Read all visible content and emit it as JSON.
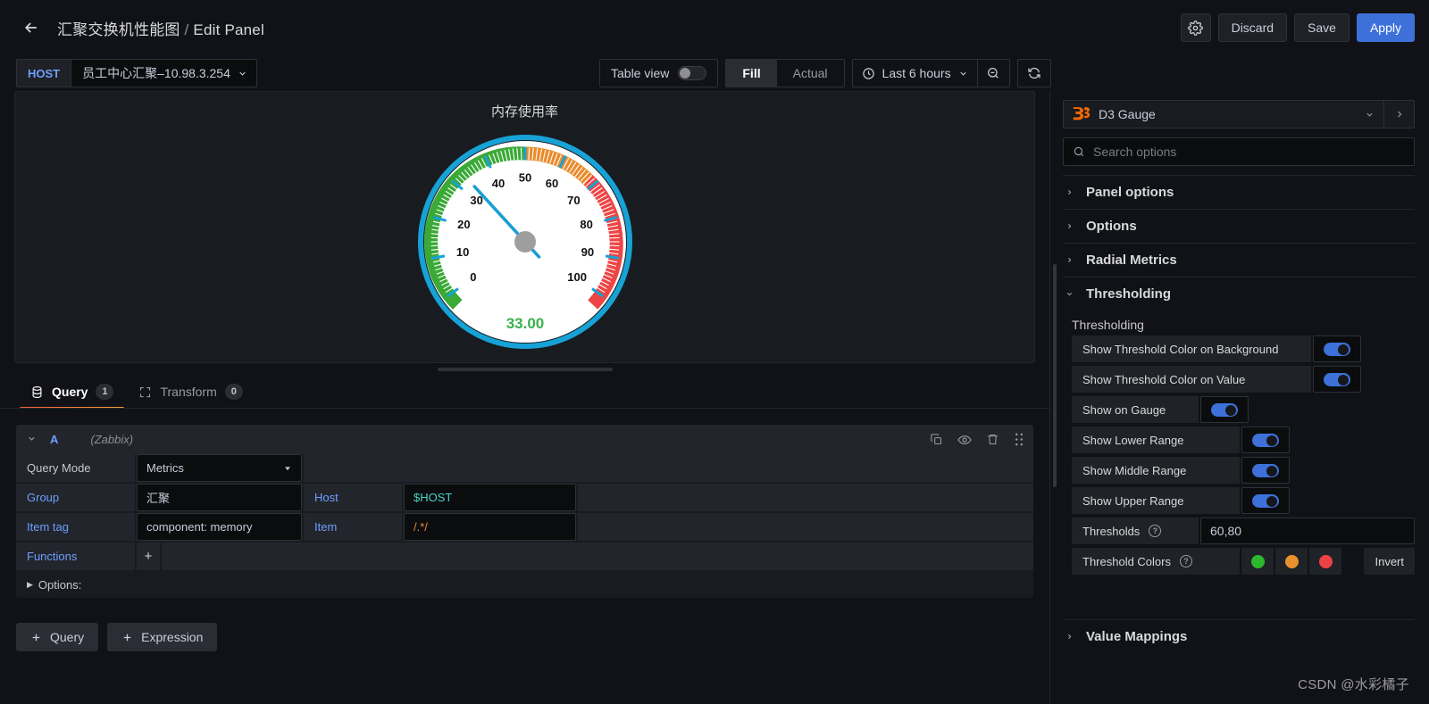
{
  "topbar": {
    "back_icon": "arrow-left-icon",
    "dashboard_title": "汇聚交换机性能图",
    "separator": "/",
    "page_title": "Edit Panel",
    "settings_icon": "gear-icon",
    "discard_label": "Discard",
    "save_label": "Save",
    "apply_label": "Apply"
  },
  "subbar": {
    "variable_label": "HOST",
    "variable_value": "员工中心汇聚–10.98.3.254",
    "table_view_label": "Table view",
    "table_view_on": false,
    "fill_label": "Fill",
    "actual_label": "Actual",
    "selected_size": "Fill",
    "time_range": "Last 6 hours",
    "clock_icon": "clock-icon",
    "zoom_out_icon": "zoom-out-icon",
    "refresh_icon": "refresh-icon"
  },
  "panel": {
    "title": "内存使用率",
    "value_text": "33.00",
    "value_color": "#37b24d"
  },
  "chart_data": {
    "type": "gauge",
    "title": "内存使用率",
    "value": 33.0,
    "value_label": "33.00",
    "min": 0,
    "max": 100,
    "tick_labels": [
      0,
      10,
      20,
      30,
      40,
      50,
      60,
      70,
      80,
      90,
      100
    ],
    "major_tick_step": 10,
    "minor_ticks_per_major": 10,
    "thresholds": [
      60,
      80
    ],
    "bands": [
      {
        "from": 0,
        "to": 60,
        "color": "#3aa935"
      },
      {
        "from": 60,
        "to": 80,
        "color": "#e98b2c"
      },
      {
        "from": 80,
        "to": 100,
        "color": "#ef4444"
      }
    ],
    "needle_color": "#1a9fd4",
    "hub_color": "#9e9e9e",
    "outer_ring_color": "#17a2d6",
    "face_color": "#ffffff",
    "background_color": "#181b1f",
    "value_color": "#37b24d",
    "start_angle_deg": -125,
    "end_angle_deg": 125
  },
  "tabs": {
    "query": {
      "label": "Query",
      "badge": "1",
      "icon": "database-icon",
      "active": true
    },
    "transform": {
      "label": "Transform",
      "badge": "0",
      "icon": "transform-icon",
      "active": false
    }
  },
  "query": {
    "ref_id": "A",
    "datasource": "(Zabbix)",
    "actions": [
      "copy-icon",
      "eye-icon",
      "trash-icon",
      "drag-handle-icon"
    ],
    "rows": [
      {
        "label": "Query Mode",
        "label_style": "plain",
        "value": "Metrics",
        "control": "select"
      }
    ],
    "group_label": "Group",
    "group_value": "汇聚",
    "host_label": "Host",
    "host_value": "$HOST",
    "item_tag_label": "Item tag",
    "item_tag_value": "component: memory",
    "item_label": "Item",
    "item_value": "/.*/",
    "functions_label": "Functions",
    "functions_add": "+",
    "options_label": "Options:",
    "add_query_label": "Query",
    "add_expression_label": "Expression",
    "add_icon": "plus-icon"
  },
  "options_pane": {
    "viz_name": "D3 Gauge",
    "viz_logo": "d3-logo-icon",
    "chevron_down_icon": "chevron-down-icon",
    "open_icon": "chevron-right-icon",
    "search_placeholder": "Search options",
    "search_icon": "search-icon",
    "sections": [
      {
        "title": "Panel options",
        "expanded": false
      },
      {
        "title": "Options",
        "expanded": false
      },
      {
        "title": "Radial Metrics",
        "expanded": false
      },
      {
        "title": "Thresholding",
        "expanded": true
      },
      {
        "title": "Value Mappings",
        "expanded": false
      }
    ],
    "thresholding": {
      "sub_title": "Thresholding",
      "toggles": [
        {
          "label": "Show Threshold Color on Background",
          "on": true,
          "label_width": 268
        },
        {
          "label": "Show Threshold Color on Value",
          "on": true,
          "label_width": 268
        },
        {
          "label": "Show on Gauge",
          "on": true,
          "label_width": 142
        },
        {
          "label": "Show Lower Range",
          "on": true,
          "label_width": 188
        },
        {
          "label": "Show Middle Range",
          "on": true,
          "label_width": 188
        },
        {
          "label": "Show Upper Range",
          "on": true,
          "label_width": 188
        }
      ],
      "thresholds_label": "Thresholds",
      "thresholds_value": "60,80",
      "threshold_colors_label": "Threshold Colors",
      "threshold_colors": [
        "#2eb82e",
        "#e8912d",
        "#ed4245"
      ],
      "invert_label": "Invert",
      "help_icon": "help-circle-icon"
    }
  },
  "watermark": "CSDN @水彩橘子"
}
